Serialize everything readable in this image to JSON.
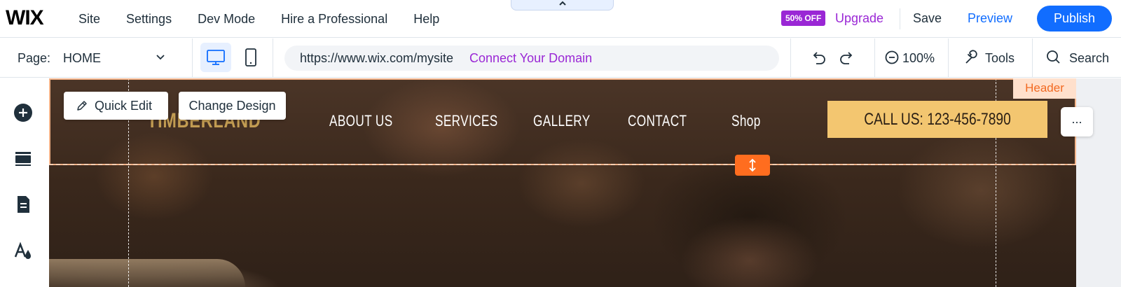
{
  "topbar": {
    "logo": "WIX",
    "menu": [
      "Site",
      "Settings",
      "Dev Mode",
      "Hire a Professional",
      "Help"
    ],
    "collapse_icon": "chevron-up-icon",
    "badge": "50% OFF",
    "upgrade": "Upgrade",
    "save": "Save",
    "preview": "Preview",
    "publish": "Publish"
  },
  "toolbar": {
    "page_label": "Page:",
    "page_value": "HOME",
    "url": "https://www.wix.com/mysite",
    "connect_domain": "Connect Your Domain",
    "zoom": "100%",
    "tools": "Tools",
    "search": "Search"
  },
  "sidebar": {
    "icons": [
      "add-elements-icon",
      "sections-icon",
      "pages-icon",
      "design-icon"
    ]
  },
  "canvas": {
    "quick_edit": "Quick Edit",
    "change_design": "Change Design",
    "brand": "TIMBERLAND",
    "nav": [
      "ABOUT US",
      "SERVICES",
      "GALLERY",
      "CONTACT",
      "Shop"
    ],
    "call_us": "CALL US: 123-456-7890",
    "header_tag": "Header",
    "more": "...",
    "colors": {
      "accent_blue": "#116dff",
      "upgrade_purple": "#9a27d5",
      "header_orange": "#f26a22",
      "call_button": "#f3c670"
    }
  }
}
